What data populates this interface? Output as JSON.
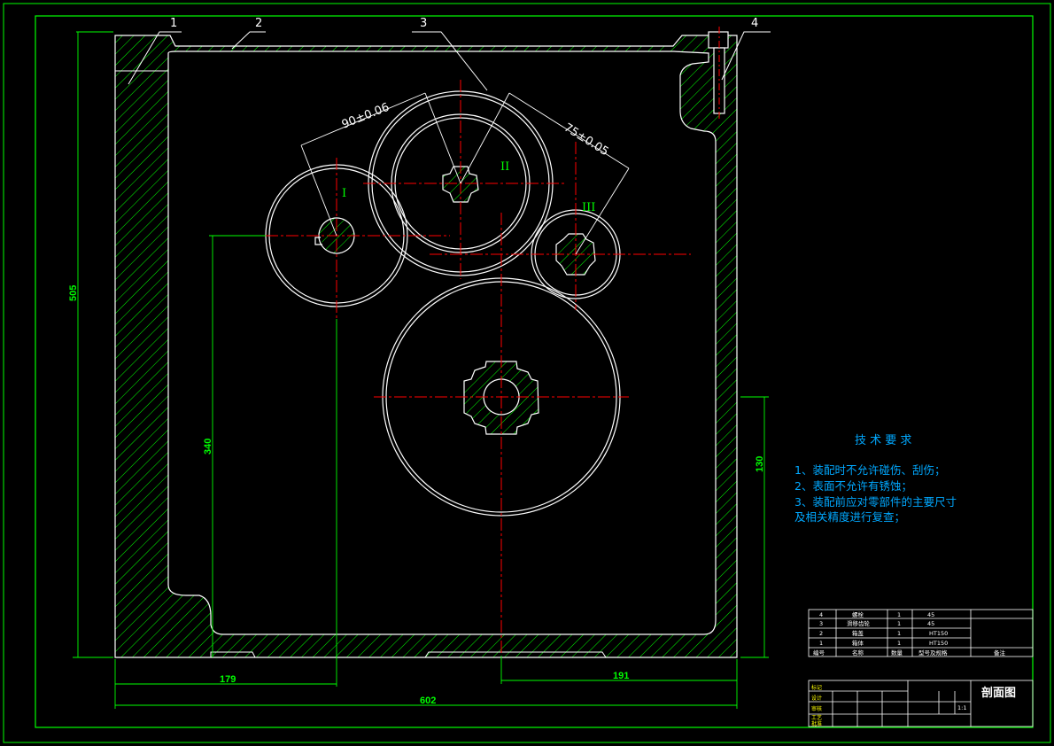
{
  "colors": {
    "background": "#000000",
    "frame": "#00ff00",
    "outline": "#ffffff",
    "hatch": "#00ff00",
    "centerline": "#ff0000",
    "dimension": "#00ff00",
    "notes": "#00a8ff"
  },
  "part_callouts": [
    "1",
    "2",
    "3",
    "4"
  ],
  "dimensions": {
    "overall_height": "505",
    "overall_width": "602",
    "left_offset": "179",
    "right_offset": "191",
    "shaft1_height": "340",
    "shaft4_height": "130",
    "center_distance_12": "90±0.06",
    "center_distance_23": "75±0.05"
  },
  "shaft_labels": [
    "I",
    "II",
    "III"
  ],
  "requirements": {
    "title": "技 术 要 求",
    "lines": [
      "1、装配时不允许碰伤、刮伤；",
      "2、表面不允许有锈蚀；",
      "3、装配前应对零部件的主要尺寸",
      "及相关精度进行复查；"
    ]
  },
  "bom": {
    "rows": [
      {
        "no": "4",
        "name": "螺栓",
        "qty": "1",
        "material": "45",
        "note": ""
      },
      {
        "no": "3",
        "name": "滑移齿轮",
        "qty": "1",
        "material": "45",
        "note": ""
      },
      {
        "no": "2",
        "name": "箱盖",
        "qty": "1",
        "material": "HT150",
        "note": ""
      },
      {
        "no": "1",
        "name": "箱体",
        "qty": "1",
        "material": "HT150",
        "note": ""
      }
    ],
    "header": {
      "no": "编号",
      "name": "名称",
      "qty": "数量",
      "material": "型号及规格",
      "note": "备注"
    }
  },
  "title_block": {
    "drawing_title": "剖面图",
    "scale": "1:1",
    "roles": [
      "标记",
      "设计",
      "审核",
      "工艺",
      "批准"
    ]
  }
}
